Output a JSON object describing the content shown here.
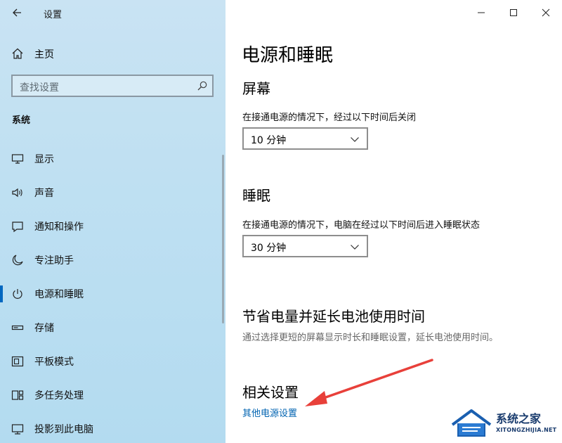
{
  "window": {
    "title": "设置"
  },
  "sidebar": {
    "home_label": "主页",
    "search_placeholder": "查找设置",
    "section": "系统",
    "items": [
      {
        "label": "显示",
        "icon": "monitor-icon"
      },
      {
        "label": "声音",
        "icon": "speaker-icon"
      },
      {
        "label": "通知和操作",
        "icon": "notification-icon"
      },
      {
        "label": "专注助手",
        "icon": "moon-icon"
      },
      {
        "label": "电源和睡眠",
        "icon": "power-icon",
        "active": true
      },
      {
        "label": "存储",
        "icon": "storage-icon"
      },
      {
        "label": "平板模式",
        "icon": "tablet-icon"
      },
      {
        "label": "多任务处理",
        "icon": "multitask-icon"
      },
      {
        "label": "投影到此电脑",
        "icon": "project-icon"
      }
    ]
  },
  "main": {
    "title": "电源和睡眠",
    "screen": {
      "heading": "屏幕",
      "desc": "在接通电源的情况下，经过以下时间后关闭",
      "value": "10 分钟"
    },
    "sleep": {
      "heading": "睡眠",
      "desc": "在接通电源的情况下，电脑在经过以下时间后进入睡眠状态",
      "value": "30 分钟"
    },
    "save": {
      "heading": "节省电量并延长电池使用时间",
      "desc": "通过选择更短的屏幕显示时长和睡眠设置，延长电池使用时间。"
    },
    "related": {
      "heading": "相关设置",
      "link": "其他电源设置"
    }
  },
  "watermark": {
    "text": "系统之家",
    "sub": "XITONGZHIJIA.NET"
  },
  "colors": {
    "accent": "#0067c0",
    "link": "#0063b1",
    "arrow": "#e8403a",
    "sidebar_bg": "#c2e0f2"
  }
}
